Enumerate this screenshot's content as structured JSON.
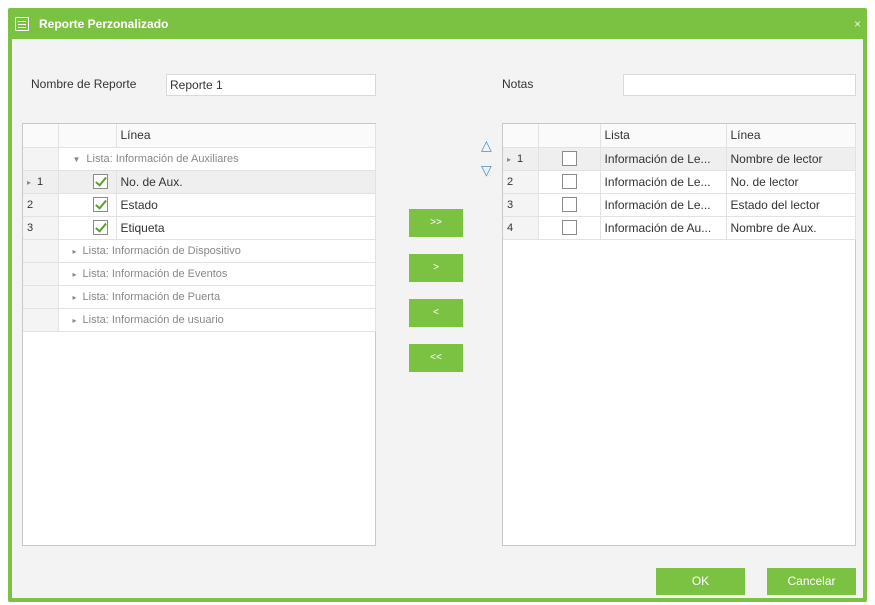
{
  "dialog": {
    "title": "Reporte Perzonalizado",
    "close": "×"
  },
  "form": {
    "report_name_label": "Nombre de Reporte",
    "report_name_value": "Reporte 1",
    "notes_label": "Notas",
    "notes_value": ""
  },
  "left_grid": {
    "header": "Línea",
    "groups": [
      {
        "label": "Lista: Información de Auxiliares",
        "arrow": "▼",
        "rows": [
          {
            "num": "1",
            "marker": "▸",
            "label": "No. de Aux.",
            "checked": true
          },
          {
            "num": "2",
            "marker": "",
            "label": "Estado",
            "checked": true
          },
          {
            "num": "3",
            "marker": "",
            "label": "Etiqueta",
            "checked": true
          }
        ]
      },
      {
        "label": "Lista: Información de Dispositivo",
        "arrow": "▸"
      },
      {
        "label": "Lista: Información de Eventos",
        "arrow": "▸"
      },
      {
        "label": "Lista: Información de Puerta",
        "arrow": "▸"
      },
      {
        "label": "Lista: Información de usuario",
        "arrow": "▸"
      }
    ]
  },
  "transfer_buttons": {
    "all_right": ">>",
    "right": ">",
    "left": "<",
    "all_left": "<<"
  },
  "order_arrows": {
    "up": "△",
    "down": "▽"
  },
  "right_grid": {
    "headers": [
      "Lista",
      "Línea"
    ],
    "rows": [
      {
        "num": "1",
        "marker": "▸",
        "lista": "Información de Le...",
        "linea": "Nombre de lector"
      },
      {
        "num": "2",
        "marker": "",
        "lista": "Información de Le...",
        "linea": "No. de lector"
      },
      {
        "num": "3",
        "marker": "",
        "lista": "Información de Le...",
        "linea": "Estado del lector"
      },
      {
        "num": "4",
        "marker": "",
        "lista": "Información de Au...",
        "linea": "Nombre de Aux."
      }
    ]
  },
  "footer": {
    "ok": "OK",
    "cancel": "Cancelar"
  },
  "colors": {
    "accent": "#7cc242",
    "order_arrow": "#4a90c8"
  }
}
